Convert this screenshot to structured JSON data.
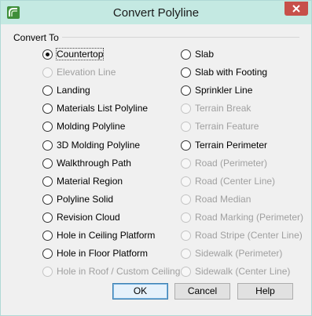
{
  "window": {
    "title": "Convert Polyline",
    "close_icon": "close-icon",
    "app_icon": "app-logo-icon"
  },
  "group": {
    "label": "Convert To"
  },
  "left_options": [
    {
      "label": "Countertop",
      "checked": true,
      "enabled": true
    },
    {
      "label": "Elevation Line",
      "checked": false,
      "enabled": false
    },
    {
      "label": "Landing",
      "checked": false,
      "enabled": true
    },
    {
      "label": "Materials List Polyline",
      "checked": false,
      "enabled": true
    },
    {
      "label": "Molding Polyline",
      "checked": false,
      "enabled": true
    },
    {
      "label": "3D Molding Polyline",
      "checked": false,
      "enabled": true
    },
    {
      "label": "Walkthrough Path",
      "checked": false,
      "enabled": true
    },
    {
      "label": "Material Region",
      "checked": false,
      "enabled": true
    },
    {
      "label": "Polyline Solid",
      "checked": false,
      "enabled": true
    },
    {
      "label": "Revision Cloud",
      "checked": false,
      "enabled": true
    },
    {
      "label": "Hole in Ceiling Platform",
      "checked": false,
      "enabled": true
    },
    {
      "label": "Hole in Floor Platform",
      "checked": false,
      "enabled": true
    },
    {
      "label": "Hole in Roof / Custom Ceiling",
      "checked": false,
      "enabled": false
    }
  ],
  "right_options": [
    {
      "label": "Slab",
      "checked": false,
      "enabled": true
    },
    {
      "label": "Slab with Footing",
      "checked": false,
      "enabled": true
    },
    {
      "label": "Sprinkler Line",
      "checked": false,
      "enabled": true
    },
    {
      "label": "Terrain Break",
      "checked": false,
      "enabled": false
    },
    {
      "label": "Terrain Feature",
      "checked": false,
      "enabled": false
    },
    {
      "label": "Terrain Perimeter",
      "checked": false,
      "enabled": true
    },
    {
      "label": "Road (Perimeter)",
      "checked": false,
      "enabled": false
    },
    {
      "label": "Road (Center Line)",
      "checked": false,
      "enabled": false
    },
    {
      "label": "Road Median",
      "checked": false,
      "enabled": false
    },
    {
      "label": "Road Marking (Perimeter)",
      "checked": false,
      "enabled": false
    },
    {
      "label": "Road Stripe (Center Line)",
      "checked": false,
      "enabled": false
    },
    {
      "label": "Sidewalk (Perimeter)",
      "checked": false,
      "enabled": false
    },
    {
      "label": "Sidewalk (Center Line)",
      "checked": false,
      "enabled": false
    }
  ],
  "buttons": {
    "ok": "OK",
    "cancel": "Cancel",
    "help": "Help"
  }
}
